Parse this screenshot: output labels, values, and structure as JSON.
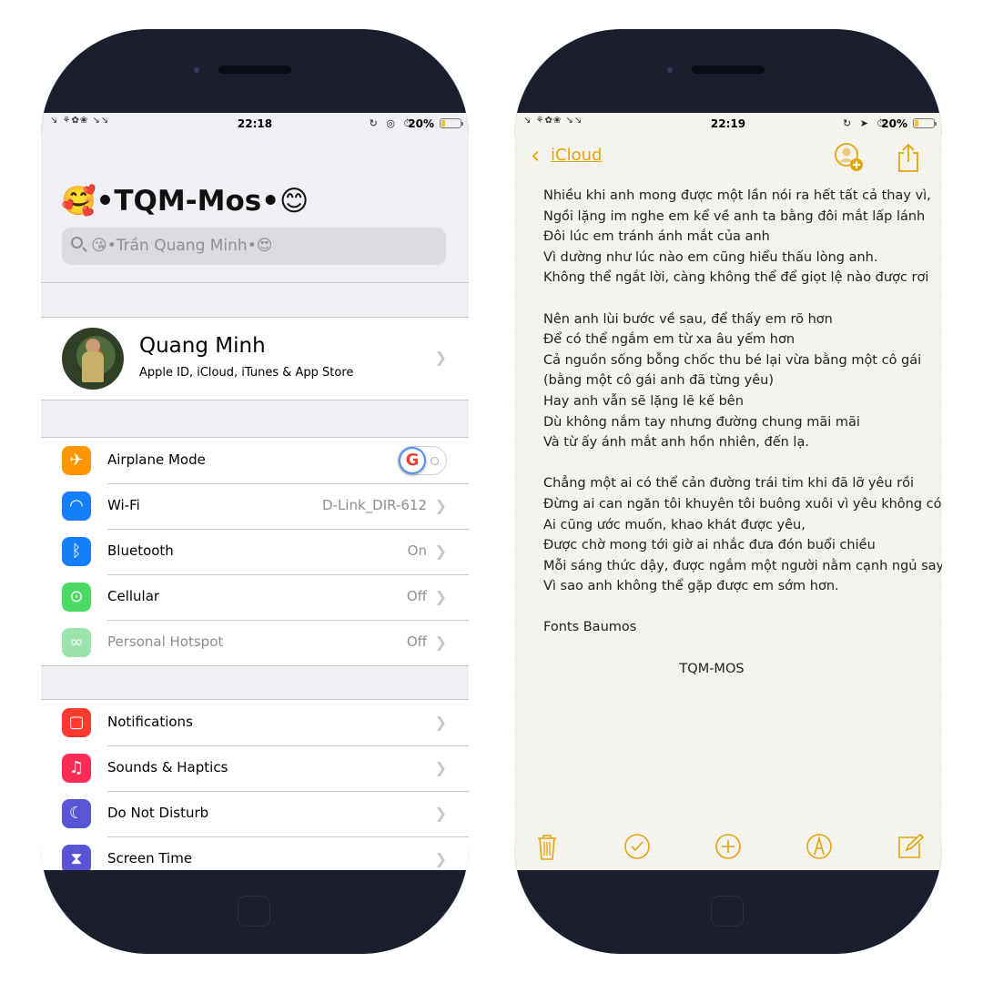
{
  "left_phone": {
    "status": {
      "time": "22:18",
      "battery": "20%",
      "battery_level": 0.2,
      "left_deco": "↘ ⚘✿❀ ↘↘",
      "indicator_icons": "↻ ◎ ⏱"
    },
    "title": "🥰•TQM-Mos•😊",
    "search_placeholder": "😘•Trần Quang Minh•😍",
    "profile": {
      "name": "Quang Minh",
      "subtitle": "Apple ID, iCloud, iTunes & App Store"
    },
    "group1": [
      {
        "label": "Airplane Mode",
        "value": "",
        "icon": "airplane-icon",
        "color": "#ff9500",
        "glyph": "✈",
        "toggle": true,
        "toggle_on": false
      },
      {
        "label": "Wi-Fi",
        "value": "D-Link_DIR-612",
        "icon": "wifi-icon",
        "color": "#157efb",
        "glyph": "◠"
      },
      {
        "label": "Bluetooth",
        "value": "On",
        "icon": "bluetooth-icon",
        "color": "#157efb",
        "glyph": "ᛒ"
      },
      {
        "label": "Cellular",
        "value": "Off",
        "icon": "cellular-antenna-icon",
        "color": "#4cd964",
        "glyph": "⊙"
      },
      {
        "label": "Personal Hotspot",
        "value": "Off",
        "icon": "hotspot-icon",
        "color": "#9de3ae",
        "glyph": "∞",
        "disabled": true
      }
    ],
    "group2": [
      {
        "label": "Notifications",
        "icon": "notifications-icon",
        "color": "#ff3b30",
        "glyph": "▢"
      },
      {
        "label": "Sounds & Haptics",
        "icon": "speaker-icon",
        "color": "#ff2d55",
        "glyph": "♫"
      },
      {
        "label": "Do Not Disturb",
        "icon": "moon-icon",
        "color": "#5856d6",
        "glyph": "☾"
      },
      {
        "label": "Screen Time",
        "icon": "hourglass-icon",
        "color": "#5856d6",
        "glyph": "⧗"
      }
    ]
  },
  "right_phone": {
    "status": {
      "time": "22:19",
      "battery": "20%",
      "battery_level": 0.2,
      "left_deco": "↘ ⚘✿❀ ↘↘",
      "indicator_icons": "↻ ➤ ⏱"
    },
    "back_label": "iCloud",
    "accent_color": "#e3a40c",
    "note_lines": [
      "Nhiều khi anh mong được một lần nói ra hết tất cả thay vì,",
      "Ngồi lặng im nghe em kể về anh ta bằng đôi mắt lấp lánh",
      "Đôi lúc em tránh ánh mắt của anh",
      "Vì dường như lúc nào em cũng hiểu thấu lòng anh.",
      "Không thể ngắt lời, càng không thể để giọt lệ nào được rơi",
      "",
      "Nên anh lùi bước về sau, để thấy em rõ hơn",
      "Để có thể ngắm em từ xa âu yếm hơn",
      "Cả nguồn sống bỗng chốc thu bé lại vừa bằng một cô gái",
      "(bằng một cô gái anh đã từng yêu)",
      "Hay anh vẫn sẽ lặng lẽ kế bên",
      "Dù không nắm tay nhưng đường chung mãi mãi",
      "Và từ ấy ánh mắt anh hồn nhiên, đến lạ.",
      "",
      "Chẳng một ai có thể cản đường trái tim khi đã lỡ yêu rồi",
      "Đừng ai can ngăn tôi khuyên tôi buông xuôi vì yêu không có lỗi",
      "Ai cũng ước muốn, khao khát được yêu,",
      "Được chờ mong tới giờ ai nhắc đưa đón buổi chiều",
      "Mỗi sáng thức dậy, được ngắm một người nằm cạnh ngủ say",
      "Vì sao anh không thể gặp được em sớm hơn.",
      "",
      "Fonts  Baumos"
    ],
    "signature": "TQM-MOS",
    "toolbar": [
      {
        "name": "trash-icon"
      },
      {
        "name": "checklist-icon"
      },
      {
        "name": "add-icon"
      },
      {
        "name": "markup-pen-icon"
      },
      {
        "name": "compose-icon"
      }
    ]
  }
}
